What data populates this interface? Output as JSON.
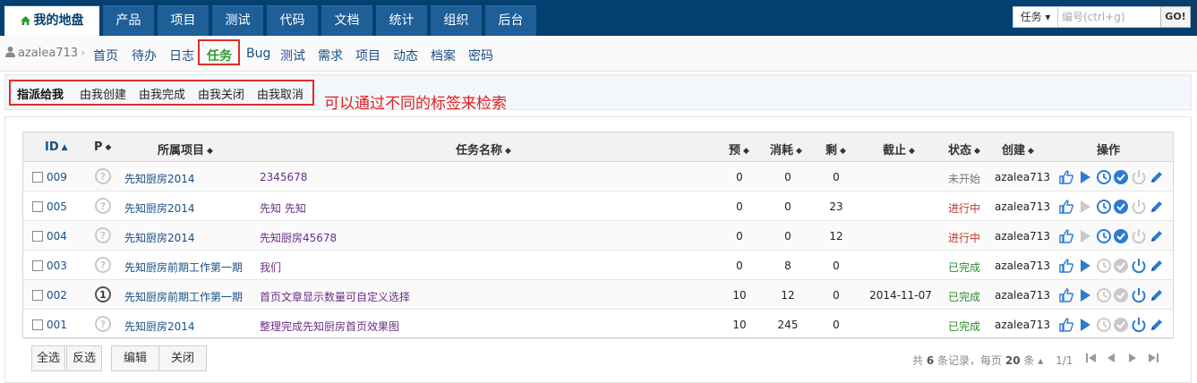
{
  "topnav": {
    "tabs": [
      {
        "label": "我的地盘",
        "active": true
      },
      {
        "label": "产品"
      },
      {
        "label": "项目"
      },
      {
        "label": "测试"
      },
      {
        "label": "代码"
      },
      {
        "label": "文档"
      },
      {
        "label": "统计"
      },
      {
        "label": "组织"
      },
      {
        "label": "后台"
      }
    ],
    "search": {
      "select_label": "任务 ▾",
      "placeholder": "编号(ctrl+g)",
      "go_label": "GO!"
    }
  },
  "subnav": {
    "user": "azalea713",
    "items": [
      "首页",
      "待办",
      "日志",
      "任务",
      "Bug",
      "测试",
      "需求",
      "项目",
      "动态",
      "档案",
      "密码"
    ],
    "active": "任务"
  },
  "filters": {
    "items": [
      "指派给我",
      "由我创建",
      "由我完成",
      "由我关闭",
      "由我取消"
    ],
    "active": "指派给我",
    "hint": "可以通过不同的标签来检索"
  },
  "table": {
    "headers": {
      "id": "ID",
      "pri": "P",
      "project": "所属项目",
      "name": "任务名称",
      "estimate": "预",
      "consumed": "消耗",
      "left": "剩",
      "deadline": "截止",
      "status": "状态",
      "creator": "创建",
      "actions": "操作"
    },
    "rows": [
      {
        "id": "009",
        "pri": "?",
        "project": "先知厨房2014",
        "name": "2345678",
        "estimate": "0",
        "consumed": "0",
        "left": "0",
        "deadline": "",
        "status": "未开始",
        "creator": "azalea713"
      },
      {
        "id": "005",
        "pri": "?",
        "project": "先知厨房2014",
        "name": "先知 先知",
        "estimate": "0",
        "consumed": "0",
        "left": "23",
        "deadline": "",
        "status": "进行中",
        "creator": "azalea713"
      },
      {
        "id": "004",
        "pri": "?",
        "project": "先知厨房2014",
        "name": "先知厨房45678",
        "estimate": "0",
        "consumed": "0",
        "left": "12",
        "deadline": "",
        "status": "进行中",
        "creator": "azalea713"
      },
      {
        "id": "003",
        "pri": "?",
        "project": "先知厨房前期工作第一期",
        "name": "我们",
        "estimate": "0",
        "consumed": "8",
        "left": "0",
        "deadline": "",
        "status": "已完成",
        "creator": "azalea713"
      },
      {
        "id": "002",
        "pri": "1",
        "project": "先知厨房前期工作第一期",
        "name": "首页文章显示数量可自定义选择",
        "estimate": "10",
        "consumed": "12",
        "left": "0",
        "deadline": "2014-11-07",
        "status": "已完成",
        "creator": "azalea713"
      },
      {
        "id": "001",
        "pri": "?",
        "project": "先知厨房2014",
        "name": "整理完成先知厨房首页效果图",
        "estimate": "10",
        "consumed": "245",
        "left": "0",
        "deadline": "",
        "status": "已完成",
        "creator": "azalea713"
      }
    ]
  },
  "footer": {
    "select_all": "全选",
    "invert": "反选",
    "edit": "编辑",
    "close": "关闭",
    "pager": {
      "total_prefix": "共",
      "total": "6",
      "total_suffix": "条记录，每页",
      "per_page": "20",
      "per_page_suffix": "条 ▴",
      "pages": "1/1"
    }
  },
  "colors": {
    "nav_bg": "#03406f",
    "tab_bg": "#1e5f97",
    "highlight_red": "#e12b2b",
    "status_done": "#2e8b2e",
    "status_doing": "#c0392b"
  }
}
